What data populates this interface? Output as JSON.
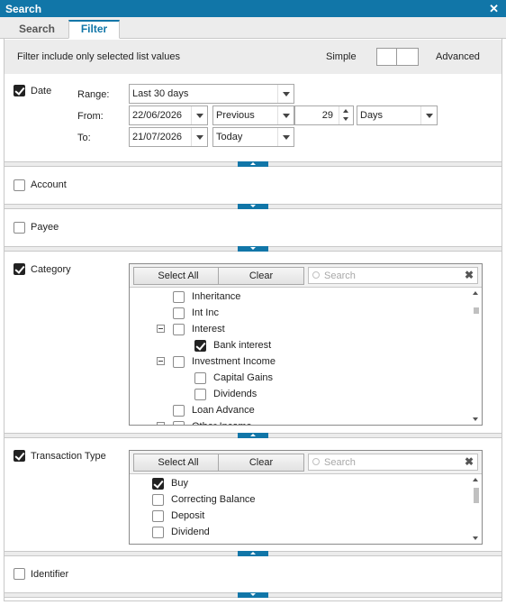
{
  "window": {
    "title": "Search",
    "close_glyph": "✕"
  },
  "tabs": [
    {
      "label": "Search",
      "active": false
    },
    {
      "label": "Filter",
      "active": true
    }
  ],
  "info": {
    "text": "Filter include only selected list values",
    "simple_label": "Simple",
    "advanced_label": "Advanced"
  },
  "date": {
    "label": "Date",
    "checked": true,
    "range_label": "Range:",
    "range_value": "Last 30 days",
    "from_label": "From:",
    "from_value": "22/06/2026",
    "from_mode": "Previous",
    "from_count": "29",
    "from_unit": "Days",
    "to_label": "To:",
    "to_value": "21/07/2026",
    "to_mode": "Today"
  },
  "account": {
    "label": "Account",
    "checked": false
  },
  "payee": {
    "label": "Payee",
    "checked": false
  },
  "category": {
    "label": "Category",
    "checked": true,
    "select_all": "Select All",
    "clear": "Clear",
    "search_placeholder": "Search",
    "items": [
      {
        "label": "Inheritance",
        "checked": false,
        "level": 1,
        "expander": false
      },
      {
        "label": "Int Inc",
        "checked": false,
        "level": 1,
        "expander": false
      },
      {
        "label": "Interest",
        "checked": false,
        "level": 1,
        "expander": true
      },
      {
        "label": "Bank interest",
        "checked": true,
        "level": 2,
        "expander": false
      },
      {
        "label": "Investment Income",
        "checked": false,
        "level": 1,
        "expander": true
      },
      {
        "label": "Capital Gains",
        "checked": false,
        "level": 2,
        "expander": false
      },
      {
        "label": "Dividends",
        "checked": false,
        "level": 2,
        "expander": false
      },
      {
        "label": "Loan Advance",
        "checked": false,
        "level": 1,
        "expander": false
      },
      {
        "label": "Other Income",
        "checked": false,
        "level": 1,
        "expander": true
      }
    ]
  },
  "transaction_type": {
    "label": "Transaction Type",
    "checked": true,
    "select_all": "Select All",
    "clear": "Clear",
    "search_placeholder": "Search",
    "items": [
      {
        "label": "Buy",
        "checked": true
      },
      {
        "label": "Correcting Balance",
        "checked": false
      },
      {
        "label": "Deposit",
        "checked": false
      },
      {
        "label": "Dividend",
        "checked": false
      }
    ]
  },
  "identifier": {
    "label": "Identifier",
    "checked": false
  },
  "colors": {
    "accent": "#1176a8",
    "panel": "#ececec",
    "border": "#c8c8c8"
  }
}
